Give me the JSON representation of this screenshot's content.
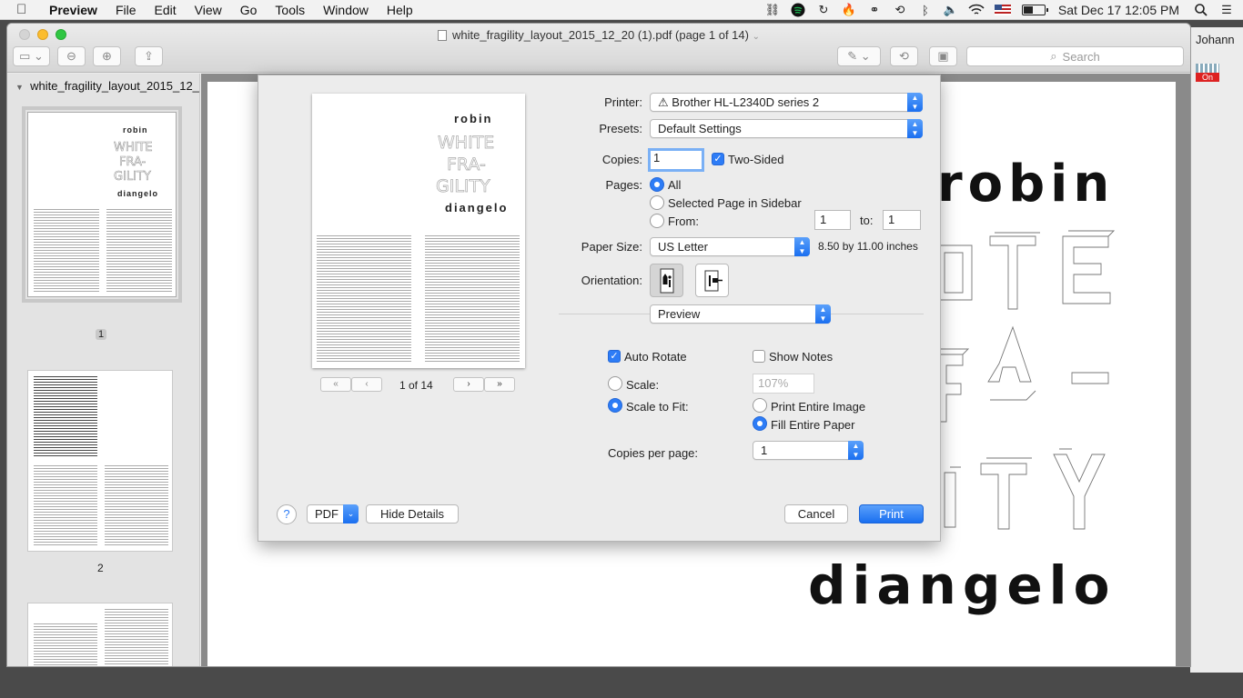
{
  "menubar": {
    "app": "Preview",
    "items": [
      "File",
      "Edit",
      "View",
      "Go",
      "Tools",
      "Window",
      "Help"
    ],
    "clock": "Sat Dec 17  12:05 PM"
  },
  "side_window": {
    "name": "Johann",
    "badge": "On"
  },
  "window": {
    "title": "white_fragility_layout_2015_12_20 (1).pdf (page 1 of 14)",
    "search_placeholder": "Search"
  },
  "sidebar": {
    "title": "white_fragility_layout_2015_12_...",
    "pages": [
      "1",
      "2"
    ]
  },
  "document": {
    "author_first": "robin",
    "author_last": "diangelo"
  },
  "print_dialog": {
    "preview": {
      "robin": "robin",
      "diangelo": "diangelo",
      "count": "1 of 14",
      "nav_first": "«",
      "nav_prev": "‹",
      "nav_next": "›",
      "nav_last": "»"
    },
    "printer_label": "Printer:",
    "printer_value": "Brother HL-L2340D series 2",
    "presets_label": "Presets:",
    "presets_value": "Default Settings",
    "copies_label": "Copies:",
    "copies_value": "1",
    "two_sided_label": "Two-Sided",
    "two_sided_checked": true,
    "pages_label": "Pages:",
    "pages_options": [
      "All",
      "Selected Page in Sidebar",
      "From:"
    ],
    "pages_selected": "All",
    "from_value": "1",
    "to_label": "to:",
    "to_value": "1",
    "paper_size_label": "Paper Size:",
    "paper_size_value": "US Letter",
    "paper_size_dims": "8.50 by 11.00 inches",
    "orientation_label": "Orientation:",
    "orientation_selected": "portrait",
    "section_value": "Preview",
    "auto_rotate_label": "Auto Rotate",
    "auto_rotate_checked": true,
    "show_notes_label": "Show Notes",
    "show_notes_checked": false,
    "scale_label": "Scale:",
    "scale_value": "107%",
    "scale_to_fit_label": "Scale to Fit:",
    "scale_mode": "Scale to Fit",
    "print_entire_image_label": "Print Entire Image",
    "fill_entire_paper_label": "Fill Entire Paper",
    "fit_mode": "Fill Entire Paper",
    "copies_per_page_label": "Copies per page:",
    "copies_per_page_value": "1",
    "help_label": "?",
    "pdf_label": "PDF",
    "hide_details_label": "Hide Details",
    "cancel_label": "Cancel",
    "print_label": "Print"
  },
  "colors": {
    "accent": "#2d7cf6"
  }
}
